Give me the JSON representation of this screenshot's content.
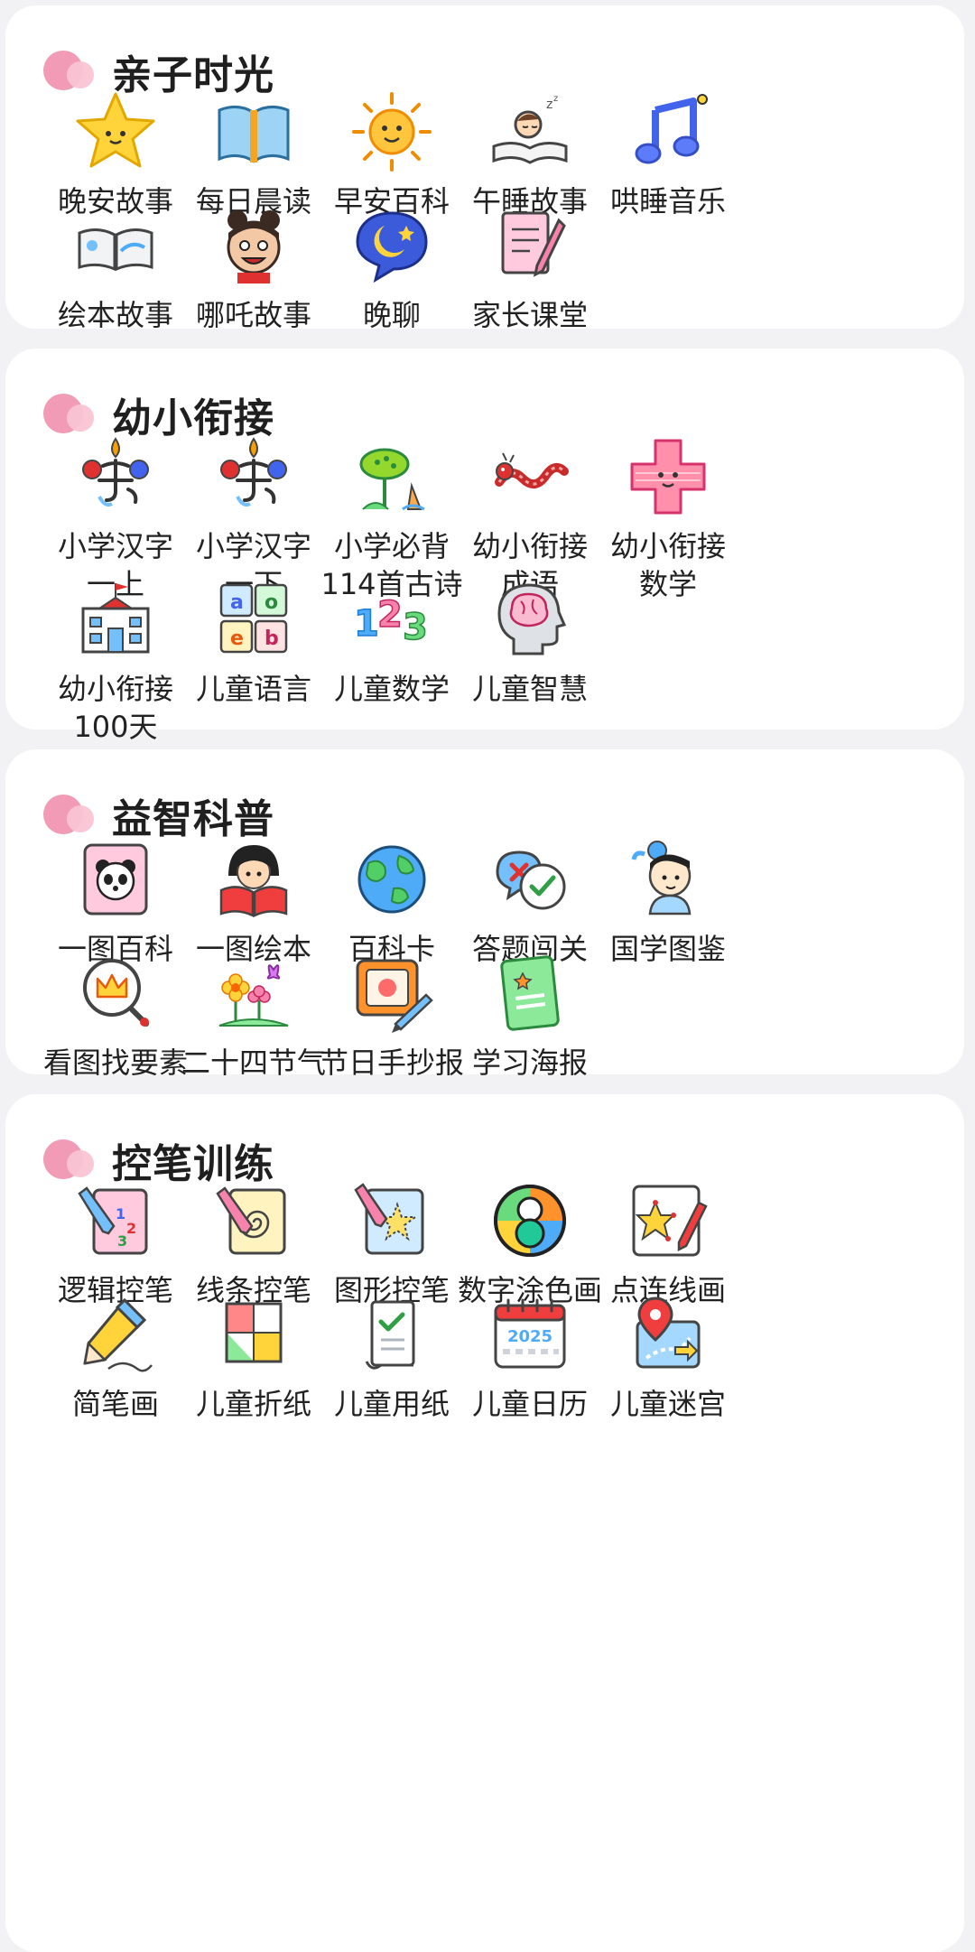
{
  "colors": {
    "background": "#f2f2f4",
    "card": "#ffffff",
    "accent_pink": "#f29bb6",
    "text": "#222222"
  },
  "sections": [
    {
      "title": "亲子时光",
      "items": [
        {
          "label": "晚安故事",
          "icon": "star-icon"
        },
        {
          "label": "每日晨读",
          "icon": "open-book-icon"
        },
        {
          "label": "早安百科",
          "icon": "sun-icon"
        },
        {
          "label": "午睡故事",
          "icon": "sleeping-child-icon"
        },
        {
          "label": "哄睡音乐",
          "icon": "music-note-icon"
        },
        {
          "label": "绘本故事",
          "icon": "picture-book-icon"
        },
        {
          "label": "哪吒故事",
          "icon": "nezha-icon"
        },
        {
          "label": "晚聊",
          "icon": "moon-chat-icon"
        },
        {
          "label": "家长课堂",
          "icon": "notebook-pencil-icon"
        }
      ]
    },
    {
      "title": "幼小衔接",
      "items": [
        {
          "label": "小学汉字\n一上",
          "icon": "hanzi-icon"
        },
        {
          "label": "小学汉字\n一下",
          "icon": "hanzi-icon"
        },
        {
          "label": "小学必背\n114首古诗",
          "icon": "lotus-icon"
        },
        {
          "label": "幼小衔接\n成语",
          "icon": "dragon-icon"
        },
        {
          "label": "幼小衔接\n数学",
          "icon": "plus-face-icon"
        },
        {
          "label": "幼小衔接\n100天",
          "icon": "school-icon"
        },
        {
          "label": "儿童语言",
          "icon": "letter-blocks-icon"
        },
        {
          "label": "儿童数学",
          "icon": "numbers-icon"
        },
        {
          "label": "儿童智慧",
          "icon": "brain-head-icon"
        }
      ]
    },
    {
      "title": "益智科普",
      "items": [
        {
          "label": "一图百科",
          "icon": "panda-card-icon"
        },
        {
          "label": "一图绘本",
          "icon": "girl-reading-icon"
        },
        {
          "label": "百科卡",
          "icon": "globe-icon"
        },
        {
          "label": "答题闯关",
          "icon": "quiz-bubbles-icon"
        },
        {
          "label": "国学图鉴",
          "icon": "ancient-child-icon"
        },
        {
          "label": "看图找要素",
          "icon": "magnifier-crown-icon"
        },
        {
          "label": "二十四节气",
          "icon": "flowers-butterfly-icon"
        },
        {
          "label": "节日手抄报",
          "icon": "drawing-board-icon"
        },
        {
          "label": "学习海报",
          "icon": "green-poster-icon"
        }
      ]
    },
    {
      "title": "控笔训练",
      "items": [
        {
          "label": "逻辑控笔",
          "icon": "logic-pen-icon"
        },
        {
          "label": "线条控笔",
          "icon": "spiral-pen-icon"
        },
        {
          "label": "图形控笔",
          "icon": "star-pen-icon"
        },
        {
          "label": "数字涂色画",
          "icon": "color-number-icon"
        },
        {
          "label": "点连线画",
          "icon": "dot-connect-icon"
        },
        {
          "label": "简笔画",
          "icon": "pencil-icon"
        },
        {
          "label": "儿童折纸",
          "icon": "origami-icon"
        },
        {
          "label": "儿童用纸",
          "icon": "paper-check-icon"
        },
        {
          "label": "儿童日历",
          "icon": "calendar-icon",
          "calendar_year": "2025"
        },
        {
          "label": "儿童迷宫",
          "icon": "maze-pin-icon"
        }
      ]
    }
  ]
}
